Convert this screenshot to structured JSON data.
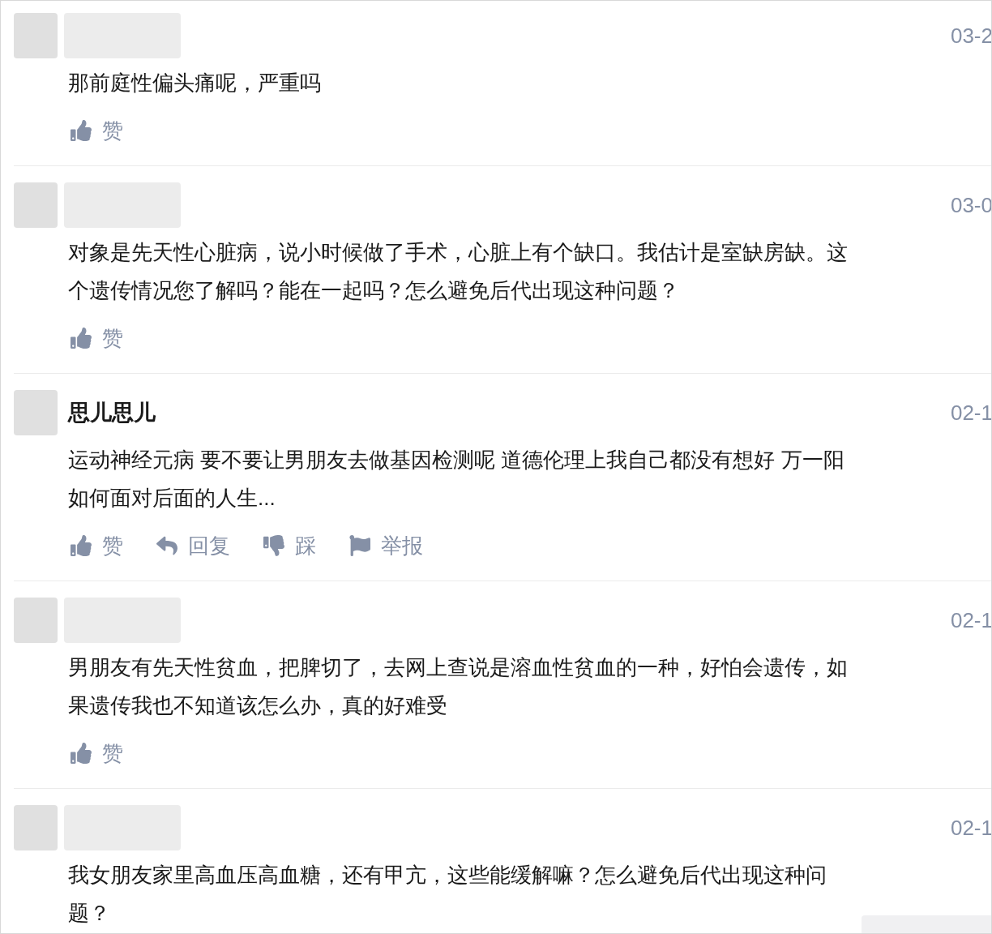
{
  "comments": [
    {
      "date": "03-2",
      "lines": [
        "那前庭性偏头痛呢，严重吗"
      ],
      "actions": [
        {
          "kind": "like",
          "label": "赞"
        }
      ]
    },
    {
      "date": "03-0",
      "lines": [
        "对象是先天性心脏病，说小时候做了手术，心脏上有个缺口。我估计是室缺房缺。这",
        "个遗传情况您了解吗？能在一起吗？怎么避免后代出现这种问题？"
      ],
      "actions": [
        {
          "kind": "like",
          "label": "赞"
        }
      ]
    },
    {
      "author": "思儿思儿",
      "date": "02-1",
      "lines": [
        "运动神经元病 要不要让男朋友去做基因检测呢 道德伦理上我自己都没有想好 万一阳",
        "如何面对后面的人生..."
      ],
      "actions": [
        {
          "kind": "like",
          "label": "赞"
        },
        {
          "kind": "reply",
          "label": "回复"
        },
        {
          "kind": "dislike",
          "label": "踩"
        },
        {
          "kind": "report",
          "label": "举报"
        }
      ]
    },
    {
      "date": "02-1",
      "lines": [
        "男朋友有先天性贫血，把脾切了，去网上查说是溶血性贫血的一种，好怕会遗传，如",
        "果遗传我也不知道该怎么办，真的好难受"
      ],
      "actions": [
        {
          "kind": "like",
          "label": "赞"
        }
      ]
    },
    {
      "date": "02-1",
      "lines": [
        "我女朋友家里高血压高血糖，还有甲亢，这些能缓解嘛？怎么避免后代出现这种问",
        "题？"
      ]
    }
  ]
}
